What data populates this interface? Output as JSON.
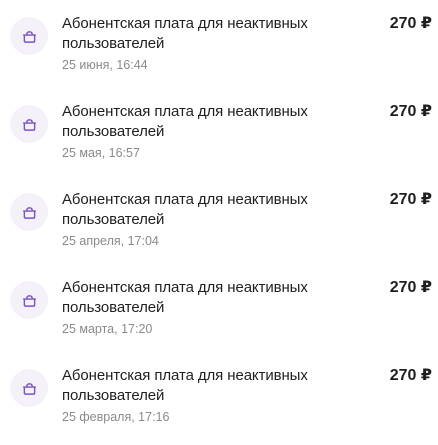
{
  "colors": {
    "icon_accent": "#7b52c7",
    "icon_background": "#f4f1f9",
    "date_text": "#8a8a8a"
  },
  "transactions": [
    {
      "icon": "wallet-icon",
      "title": "Абонентская плата для неактивных пользователей",
      "date": "25 июня, 16:44",
      "amount": "270 ₽"
    },
    {
      "icon": "wallet-icon",
      "title": "Абонентская плата для неактивных пользователей",
      "date": "25 мая, 16:57",
      "amount": "270 ₽"
    },
    {
      "icon": "wallet-icon",
      "title": "Абонентская плата для неактивных пользователей",
      "date": "25 апреля, 17:04",
      "amount": "270 ₽"
    },
    {
      "icon": "wallet-icon",
      "title": "Абонентская плата для неактивных пользователей",
      "date": "25 марта, 17:20",
      "amount": "270 ₽"
    },
    {
      "icon": "wallet-icon",
      "title": "Абонентская плата для неактивных пользователей",
      "date": "25 февраля, 17:16",
      "amount": "270 ₽"
    }
  ]
}
